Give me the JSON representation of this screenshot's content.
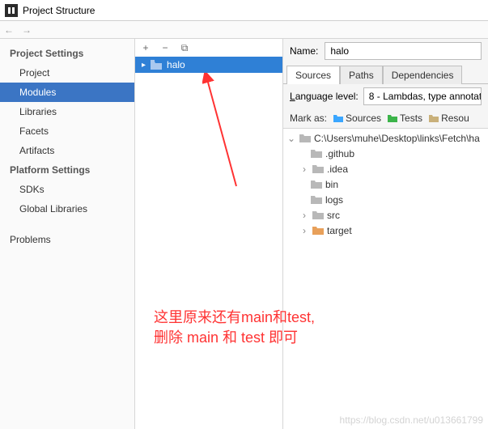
{
  "window": {
    "title": "Project Structure"
  },
  "sidebar": {
    "sections": [
      {
        "heading": "Project Settings",
        "items": [
          {
            "label": "Project",
            "selected": false
          },
          {
            "label": "Modules",
            "selected": true
          },
          {
            "label": "Libraries",
            "selected": false
          },
          {
            "label": "Facets",
            "selected": false
          },
          {
            "label": "Artifacts",
            "selected": false
          }
        ]
      },
      {
        "heading": "Platform Settings",
        "items": [
          {
            "label": "SDKs",
            "selected": false
          },
          {
            "label": "Global Libraries",
            "selected": false
          }
        ]
      },
      {
        "heading_blank": true,
        "items": [
          {
            "label": "Problems",
            "selected": false
          }
        ]
      }
    ]
  },
  "modules": {
    "tools": {
      "add": "+",
      "remove": "−",
      "copy": "⧉"
    },
    "items": [
      {
        "name": "halo",
        "selected": true
      }
    ]
  },
  "details": {
    "name_label": "Name:",
    "name_value": "halo",
    "tabs": [
      "Sources",
      "Paths",
      "Dependencies"
    ],
    "active_tab": 0,
    "language_label_pre": "L",
    "language_label_post": "anguage level:",
    "language_value": "8 - Lambdas, type annotat",
    "mark_label": "Mark as:",
    "mark_items": [
      {
        "label": "Sources",
        "color": "#3aa6ff"
      },
      {
        "label": "Tests",
        "color": "#3cb44a"
      },
      {
        "label": "Resou",
        "color": "#c9b07a"
      }
    ],
    "tree_root": "C:\\Users\\muhe\\Desktop\\links\\Fetch\\ha",
    "tree_children": [
      {
        "name": ".github",
        "expandable": false,
        "color": "#b8b8b8"
      },
      {
        "name": ".idea",
        "expandable": true,
        "color": "#b8b8b8"
      },
      {
        "name": "bin",
        "expandable": false,
        "color": "#b8b8b8"
      },
      {
        "name": "logs",
        "expandable": false,
        "color": "#b8b8b8"
      },
      {
        "name": "src",
        "expandable": true,
        "color": "#b8b8b8"
      },
      {
        "name": "target",
        "expandable": true,
        "color": "#e8a05a"
      }
    ]
  },
  "annotation": {
    "line1": "这里原来还有main和test,",
    "line2": "删除 main 和 test 即可"
  },
  "watermark": "https://blog.csdn.net/u013661799"
}
